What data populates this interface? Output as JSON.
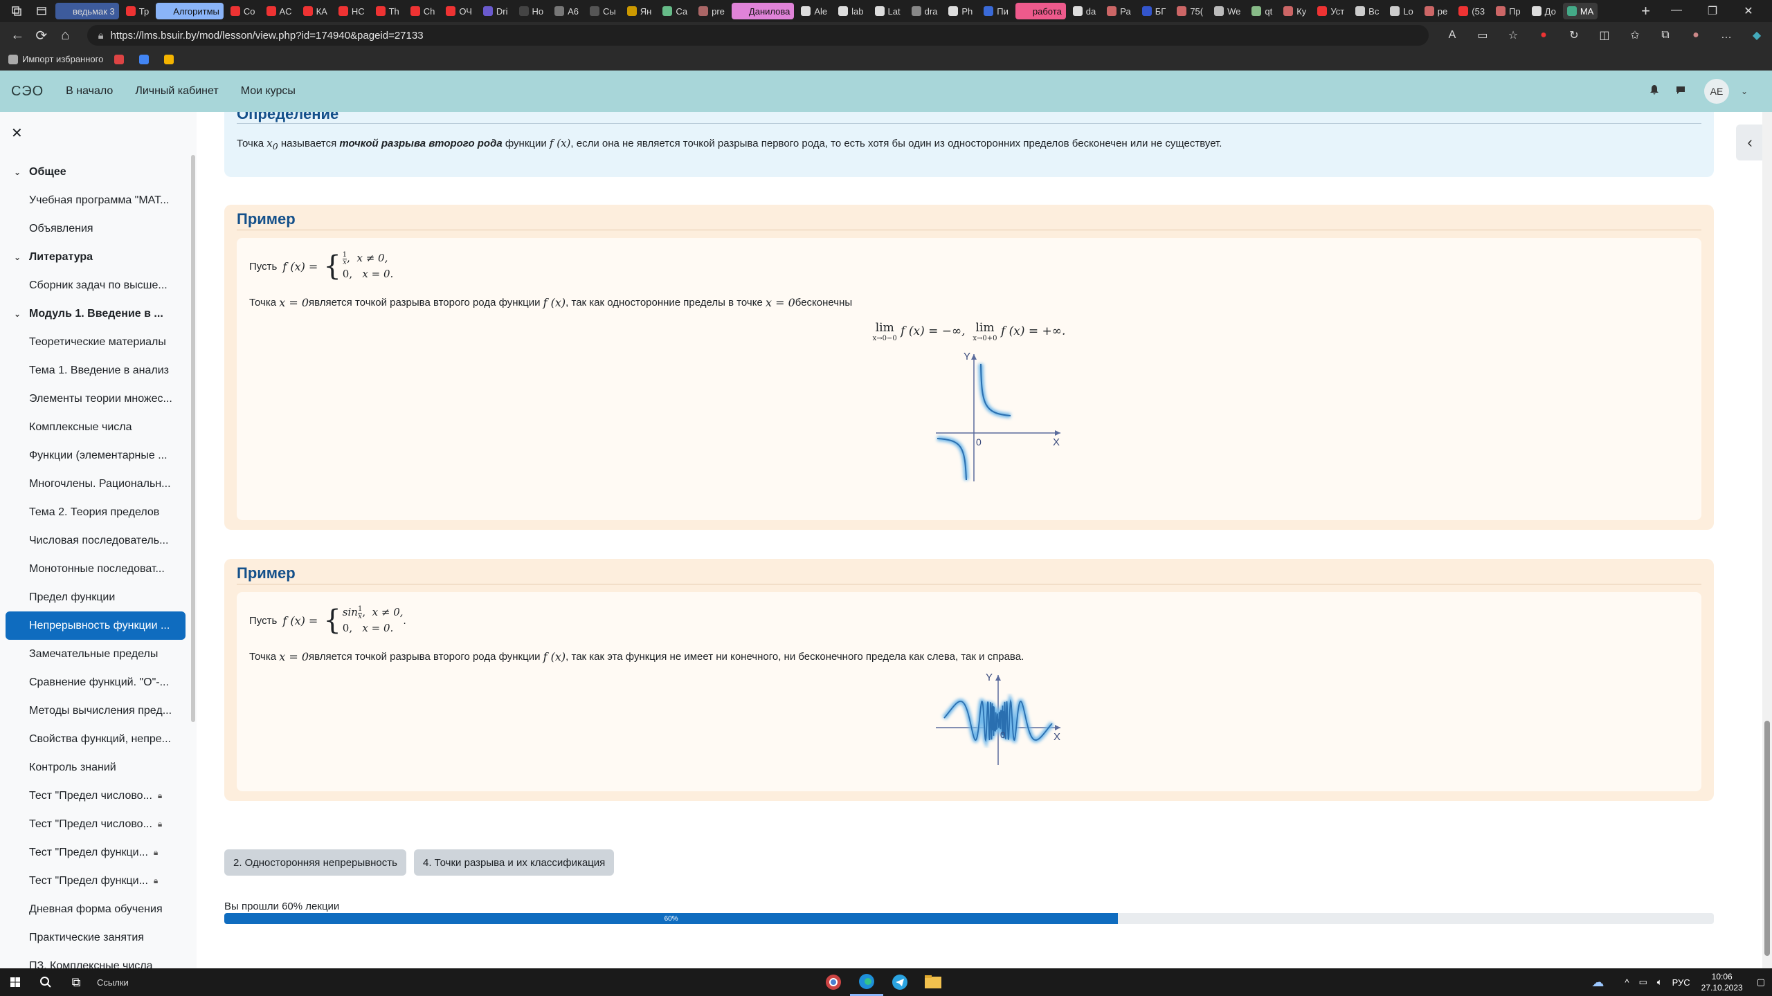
{
  "browser": {
    "tabs": [
      {
        "label": "ведьмак 3",
        "style": "group-blue",
        "fav": "#3d5b9c"
      },
      {
        "label": "Тр",
        "style": "",
        "fav": "#e33"
      },
      {
        "label": "Алгоритмы",
        "style": "group-light",
        "fav": "#8ab4f8"
      },
      {
        "label": "Co",
        "style": "",
        "fav": "#e33"
      },
      {
        "label": "AC",
        "style": "",
        "fav": "#e33"
      },
      {
        "label": "КА",
        "style": "",
        "fav": "#e33"
      },
      {
        "label": "НС",
        "style": "",
        "fav": "#e33"
      },
      {
        "label": "Th",
        "style": "",
        "fav": "#e33"
      },
      {
        "label": "Ch",
        "style": "",
        "fav": "#e33"
      },
      {
        "label": "ОЧ",
        "style": "",
        "fav": "#e33"
      },
      {
        "label": "Dri",
        "style": "",
        "fav": "#6a5acd"
      },
      {
        "label": "Ho",
        "style": "",
        "fav": "#444"
      },
      {
        "label": "A6",
        "style": "",
        "fav": "#777"
      },
      {
        "label": "Сы",
        "style": "",
        "fav": "#555"
      },
      {
        "label": "Ян",
        "style": "",
        "fav": "#c90"
      },
      {
        "label": "Са",
        "style": "",
        "fav": "#6b8"
      },
      {
        "label": "pre",
        "style": "",
        "fav": "#a66"
      },
      {
        "label": "Данилова",
        "style": "group-pink",
        "fav": "#e083d8"
      },
      {
        "label": "Ale",
        "style": "",
        "fav": "#ddd"
      },
      {
        "label": "lab",
        "style": "",
        "fav": "#ddd"
      },
      {
        "label": "Lat",
        "style": "",
        "fav": "#ddd"
      },
      {
        "label": "dra",
        "style": "",
        "fav": "#888"
      },
      {
        "label": "Ph",
        "style": "",
        "fav": "#ddd"
      },
      {
        "label": "Пи",
        "style": "",
        "fav": "#3a6ad8"
      },
      {
        "label": "работа",
        "style": "group-red",
        "fav": "#ee5a8c"
      },
      {
        "label": "da",
        "style": "",
        "fav": "#ddd"
      },
      {
        "label": "Ра",
        "style": "",
        "fav": "#c66"
      },
      {
        "label": "БГ",
        "style": "",
        "fav": "#35c"
      },
      {
        "label": "75(",
        "style": "",
        "fav": "#c66"
      },
      {
        "label": "We",
        "style": "",
        "fav": "#bbb"
      },
      {
        "label": "qt",
        "style": "",
        "fav": "#8b8"
      },
      {
        "label": "Ку",
        "style": "",
        "fav": "#c66"
      },
      {
        "label": "Уст",
        "style": "",
        "fav": "#e33"
      },
      {
        "label": "Вс",
        "style": "",
        "fav": "#ccc"
      },
      {
        "label": "Lo",
        "style": "",
        "fav": "#ccc"
      },
      {
        "label": "ре",
        "style": "",
        "fav": "#c66"
      },
      {
        "label": "(53",
        "style": "",
        "fav": "#e33"
      },
      {
        "label": "Пр",
        "style": "",
        "fav": "#c66"
      },
      {
        "label": "До",
        "style": "",
        "fav": "#ddd"
      },
      {
        "label": "МА",
        "style": "active",
        "fav": "#4a8"
      }
    ],
    "url": "https://lms.bsuir.by/mod/lesson/view.php?id=174940&pageid=27133",
    "bookmarks": [
      {
        "label": "Импорт избранного",
        "color": "#aaa"
      },
      {
        "label": "",
        "color": "#d44"
      },
      {
        "label": "",
        "color": "#4285f4"
      },
      {
        "label": "",
        "color": "#f4b400"
      }
    ]
  },
  "site": {
    "logo": "СЭО",
    "nav": [
      "В начало",
      "Личный кабинет",
      "Мои курсы"
    ],
    "user_initials": "АЕ"
  },
  "drawer": {
    "items": [
      {
        "label": "Общее",
        "type": "section"
      },
      {
        "label": "Учебная программа \"МАТ...",
        "type": "item"
      },
      {
        "label": "Объявления",
        "type": "item"
      },
      {
        "label": "Литература",
        "type": "section"
      },
      {
        "label": "Сборник задач по высше...",
        "type": "item"
      },
      {
        "label": "Модуль 1. Введение в ...",
        "type": "section"
      },
      {
        "label": "Теоретические материалы",
        "type": "item"
      },
      {
        "label": "Тема 1. Введение в анализ",
        "type": "item"
      },
      {
        "label": "Элементы теории множес...",
        "type": "item"
      },
      {
        "label": "Комплексные числа",
        "type": "item"
      },
      {
        "label": "Функции (элементарные ...",
        "type": "item"
      },
      {
        "label": "Многочлены. Рациональн...",
        "type": "item"
      },
      {
        "label": "Тема 2. Теория пределов",
        "type": "item"
      },
      {
        "label": "Числовая последователь...",
        "type": "item"
      },
      {
        "label": "Монотонные последоват...",
        "type": "item"
      },
      {
        "label": "Предел функции",
        "type": "item"
      },
      {
        "label": "Непрерывность функции ...",
        "type": "active"
      },
      {
        "label": "Замечательные пределы",
        "type": "item"
      },
      {
        "label": "Сравнение функций. \"O\"-...",
        "type": "item"
      },
      {
        "label": "Методы вычисления пред...",
        "type": "item"
      },
      {
        "label": "Свойства функций, непре...",
        "type": "item"
      },
      {
        "label": "Контроль знаний",
        "type": "item"
      },
      {
        "label": "Тест \"Предел числово...",
        "type": "locked"
      },
      {
        "label": "Тест \"Предел числово...",
        "type": "locked"
      },
      {
        "label": "Тест \"Предел функци...",
        "type": "locked"
      },
      {
        "label": "Тест \"Предел функци...",
        "type": "locked"
      },
      {
        "label": "Дневная форма обучения",
        "type": "item"
      },
      {
        "label": "Практические занятия",
        "type": "item"
      },
      {
        "label": "ПЗ. Комплексные числа",
        "type": "item"
      }
    ]
  },
  "content": {
    "definition": {
      "title": "Определение",
      "text_before": "Точка ",
      "var": "x",
      "var_sub": "0",
      "text_mid": " называется ",
      "bold": "точкой разрыва второго рода",
      "text_after_bold": " функции ",
      "func": "f (x)",
      "text_end": ", если она не является точкой разрыва первого рода, то есть хотя бы один из односторонних пределов бесконечен или не существует."
    },
    "example1": {
      "title": "Пример",
      "let": "Пусть",
      "func": "f (x) =",
      "case1_expr": "1/x,",
      "case1_num": "1",
      "case1_den": "x",
      "case1_cond": "x ≠ 0,",
      "case2_expr": "0,",
      "case2_cond": "x = 0.",
      "line2_a": "Точка ",
      "line2_math1": "x = 0",
      "line2_b": " является точкой разрыва второго рода функции ",
      "line2_math2": "f (x)",
      "line2_c": ", так как односторонние пределы в точке ",
      "line2_math3": "x = 0",
      "line2_d": " бесконечны",
      "lim1": "lim",
      "lim1_sub": "x→0−0",
      "lim1_expr": "f (x) = −∞,",
      "lim2": "lim",
      "lim2_sub": "x→0+0",
      "lim2_expr": "f (x) = +∞.",
      "graph": {
        "y": "Y",
        "x": "X",
        "origin": "0"
      }
    },
    "example2": {
      "title": "Пример",
      "let": "Пусть",
      "func": "f (x) =",
      "case1_sin": "sin",
      "case1_num": "1",
      "case1_den": "x",
      "case1_cond": "x ≠ 0,",
      "case2_expr": "0,",
      "case2_cond": "x = 0.",
      "dot": ".",
      "line2_a": "Точка ",
      "line2_math1": "x = 0",
      "line2_b": " является точкой разрыва второго рода функции ",
      "line2_math2": "f (x)",
      "line2_c": ", так как эта функция не имеет ни конечного, ни бесконечного предела как слева, так и справа.",
      "graph": {
        "y": "Y",
        "x": "X",
        "origin": "0"
      }
    },
    "prev_button": "2. Односторонняя непрерывность",
    "next_button": "4. Точки разрыва и их классификация",
    "progress_label": "Вы прошли 60% лекции",
    "progress_value": 60,
    "progress_text": "60%"
  },
  "taskbar": {
    "search": "Ссылки",
    "lang": "РУС",
    "time": "10:06",
    "date": "27.10.2023"
  },
  "colors": {
    "accent": "#0f6cbf",
    "navbar": "#a8d6d9",
    "heading": "#14508a"
  }
}
